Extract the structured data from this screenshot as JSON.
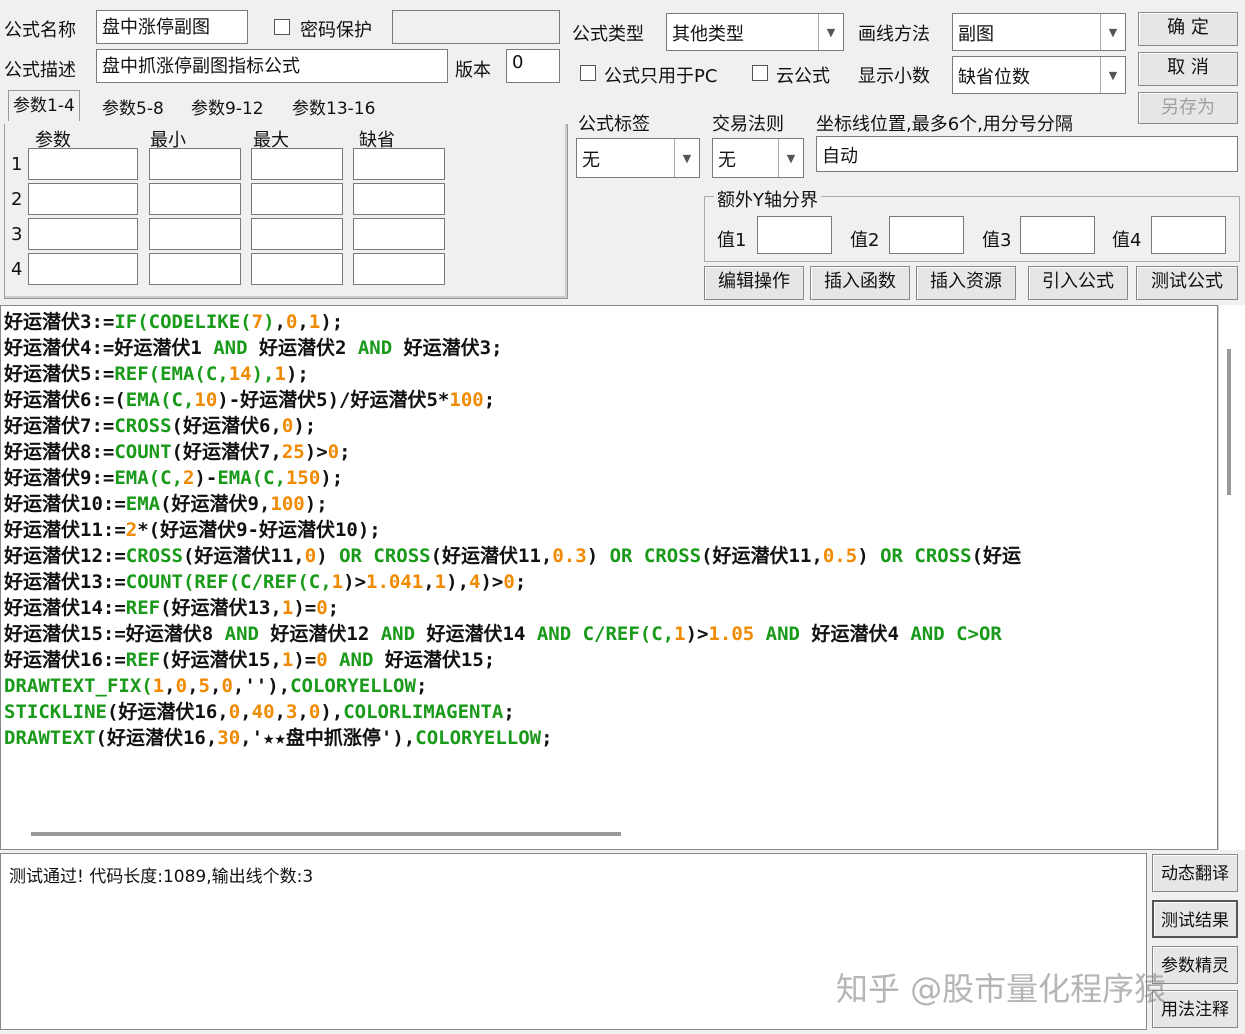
{
  "header": {
    "name_label": "公式名称",
    "name_value": "盘中涨停副图",
    "password_label": "密码保护",
    "desc_label": "公式描述",
    "desc_value": "盘中抓涨停副图指标公式",
    "version_label": "版本",
    "version_value": "0",
    "type_label": "公式类型",
    "type_value": "其他类型",
    "draw_label": "画线方法",
    "draw_value": "副图",
    "pc_only_label": "公式只用于PC",
    "cloud_label": "云公式",
    "decimals_label": "显示小数",
    "decimals_value": "缺省位数",
    "ok": "确  定",
    "cancel": "取  消",
    "save_as": "另存为"
  },
  "params": {
    "tabs": [
      "参数1-4",
      "参数5-8",
      "参数9-12",
      "参数13-16"
    ],
    "columns": [
      "参数",
      "最小",
      "最大",
      "缺省"
    ],
    "rows": [
      "1",
      "2",
      "3",
      "4"
    ]
  },
  "tags": {
    "tag_label": "公式标签",
    "tag_value": "无",
    "rule_label": "交易法则",
    "rule_value": "无",
    "axis_label": "坐标线位置,最多6个,用分号分隔",
    "axis_value": "自动",
    "yaxis_group": "额外Y轴分界",
    "values": [
      "值1",
      "值2",
      "值3",
      "值4"
    ]
  },
  "toolbar": [
    "编辑操作",
    "插入函数",
    "插入资源",
    "引入公式",
    "测试公式"
  ],
  "code": [
    [
      [
        "t",
        "好运潜伏3:="
      ],
      [
        "k",
        "IF(CODELIKE("
      ],
      [
        "n",
        "7"
      ],
      [
        "k",
        ")"
      ],
      [
        "t",
        ","
      ],
      [
        "n",
        "0"
      ],
      [
        "t",
        ","
      ],
      [
        "n",
        "1"
      ],
      [
        "t",
        ");"
      ]
    ],
    [
      [
        "t",
        "好运潜伏4:=好运潜伏1 "
      ],
      [
        "k",
        "AND"
      ],
      [
        "t",
        " 好运潜伏2 "
      ],
      [
        "k",
        "AND"
      ],
      [
        "t",
        " 好运潜伏3;"
      ]
    ],
    [
      [
        "t",
        "好运潜伏5:="
      ],
      [
        "k",
        "REF(EMA(C,"
      ],
      [
        "n",
        "14"
      ],
      [
        "k",
        "),"
      ],
      [
        "n",
        "1"
      ],
      [
        "t",
        ");"
      ]
    ],
    [
      [
        "t",
        "好运潜伏6:=("
      ],
      [
        "k",
        "EMA(C,"
      ],
      [
        "n",
        "10"
      ],
      [
        "t",
        ")-好运潜伏5)/好运潜伏5*"
      ],
      [
        "n",
        "100"
      ],
      [
        "t",
        ";"
      ]
    ],
    [
      [
        "t",
        "好运潜伏7:="
      ],
      [
        "k",
        "CROSS"
      ],
      [
        "t",
        "(好运潜伏6,"
      ],
      [
        "n",
        "0"
      ],
      [
        "t",
        ");"
      ]
    ],
    [
      [
        "t",
        "好运潜伏8:="
      ],
      [
        "k",
        "COUNT"
      ],
      [
        "t",
        "(好运潜伏7,"
      ],
      [
        "n",
        "25"
      ],
      [
        "t",
        ")>"
      ],
      [
        "n",
        "0"
      ],
      [
        "t",
        ";"
      ]
    ],
    [
      [
        "t",
        "好运潜伏9:="
      ],
      [
        "k",
        "EMA(C,"
      ],
      [
        "n",
        "2"
      ],
      [
        "t",
        ")-"
      ],
      [
        "k",
        "EMA(C,"
      ],
      [
        "n",
        "150"
      ],
      [
        "t",
        ");"
      ]
    ],
    [
      [
        "t",
        "好运潜伏10:="
      ],
      [
        "k",
        "EMA"
      ],
      [
        "t",
        "(好运潜伏9,"
      ],
      [
        "n",
        "100"
      ],
      [
        "t",
        ");"
      ]
    ],
    [
      [
        "t",
        "好运潜伏11:="
      ],
      [
        "n",
        "2"
      ],
      [
        "t",
        "*(好运潜伏9-好运潜伏10);"
      ]
    ],
    [
      [
        "t",
        "好运潜伏12:="
      ],
      [
        "k",
        "CROSS"
      ],
      [
        "t",
        "(好运潜伏11,"
      ],
      [
        "n",
        "0"
      ],
      [
        "t",
        ") "
      ],
      [
        "k",
        "OR CROSS"
      ],
      [
        "t",
        "(好运潜伏11,"
      ],
      [
        "n",
        "0.3"
      ],
      [
        "t",
        ") "
      ],
      [
        "k",
        "OR CROSS"
      ],
      [
        "t",
        "(好运潜伏11,"
      ],
      [
        "n",
        "0.5"
      ],
      [
        "t",
        ") "
      ],
      [
        "k",
        "OR CROSS"
      ],
      [
        "t",
        "(好运"
      ]
    ],
    [
      [
        "t",
        "好运潜伏13:="
      ],
      [
        "k",
        "COUNT(REF(C/REF(C,"
      ],
      [
        "n",
        "1"
      ],
      [
        "t",
        ")>"
      ],
      [
        "n",
        "1.041"
      ],
      [
        "t",
        ","
      ],
      [
        "n",
        "1"
      ],
      [
        "t",
        "),"
      ],
      [
        "n",
        "4"
      ],
      [
        "t",
        ")>"
      ],
      [
        "n",
        "0"
      ],
      [
        "t",
        ";"
      ]
    ],
    [
      [
        "t",
        "好运潜伏14:="
      ],
      [
        "k",
        "REF"
      ],
      [
        "t",
        "(好运潜伏13,"
      ],
      [
        "n",
        "1"
      ],
      [
        "t",
        ")="
      ],
      [
        "n",
        "0"
      ],
      [
        "t",
        ";"
      ]
    ],
    [
      [
        "t",
        "好运潜伏15:=好运潜伏8 "
      ],
      [
        "k",
        "AND"
      ],
      [
        "t",
        " 好运潜伏12 "
      ],
      [
        "k",
        "AND"
      ],
      [
        "t",
        " 好运潜伏14 "
      ],
      [
        "k",
        "AND C/REF(C,"
      ],
      [
        "n",
        "1"
      ],
      [
        "t",
        ")>"
      ],
      [
        "n",
        "1.05"
      ],
      [
        "t",
        " "
      ],
      [
        "k",
        "AND"
      ],
      [
        "t",
        " 好运潜伏4 "
      ],
      [
        "k",
        "AND C>OR"
      ]
    ],
    [
      [
        "t",
        "好运潜伏16:="
      ],
      [
        "k",
        "REF"
      ],
      [
        "t",
        "(好运潜伏15,"
      ],
      [
        "n",
        "1"
      ],
      [
        "t",
        ")="
      ],
      [
        "n",
        "0"
      ],
      [
        "t",
        " "
      ],
      [
        "k",
        "AND"
      ],
      [
        "t",
        " 好运潜伏15;"
      ]
    ],
    [
      [
        "k",
        "DRAWTEXT_FIX("
      ],
      [
        "n",
        "1"
      ],
      [
        "t",
        ","
      ],
      [
        "n",
        "0"
      ],
      [
        "t",
        ","
      ],
      [
        "n",
        "5"
      ],
      [
        "t",
        ","
      ],
      [
        "n",
        "0"
      ],
      [
        "t",
        ",''),"
      ],
      [
        "k",
        "COLORYELLOW"
      ],
      [
        "t",
        ";"
      ]
    ],
    [
      [
        "k",
        "STICKLINE"
      ],
      [
        "t",
        "(好运潜伏16,"
      ],
      [
        "n",
        "0"
      ],
      [
        "t",
        ","
      ],
      [
        "n",
        "40"
      ],
      [
        "t",
        ","
      ],
      [
        "n",
        "3"
      ],
      [
        "t",
        ","
      ],
      [
        "n",
        "0"
      ],
      [
        "t",
        "),"
      ],
      [
        "k",
        "COLORLIMAGENTA"
      ],
      [
        "t",
        ";"
      ]
    ],
    [
      [
        "k",
        "DRAWTEXT"
      ],
      [
        "t",
        "(好运潜伏16,"
      ],
      [
        "n",
        "30"
      ],
      [
        "t",
        ",'★★盘中抓涨停'),"
      ],
      [
        "k",
        "COLORYELLOW"
      ],
      [
        "t",
        ";"
      ]
    ]
  ],
  "output": {
    "message": "测试通过! 代码长度:1089,输出线个数:3"
  },
  "side_buttons": [
    "动态翻译",
    "测试结果",
    "参数精灵",
    "用法注释"
  ],
  "watermark": "知乎 @股市量化程序猿"
}
